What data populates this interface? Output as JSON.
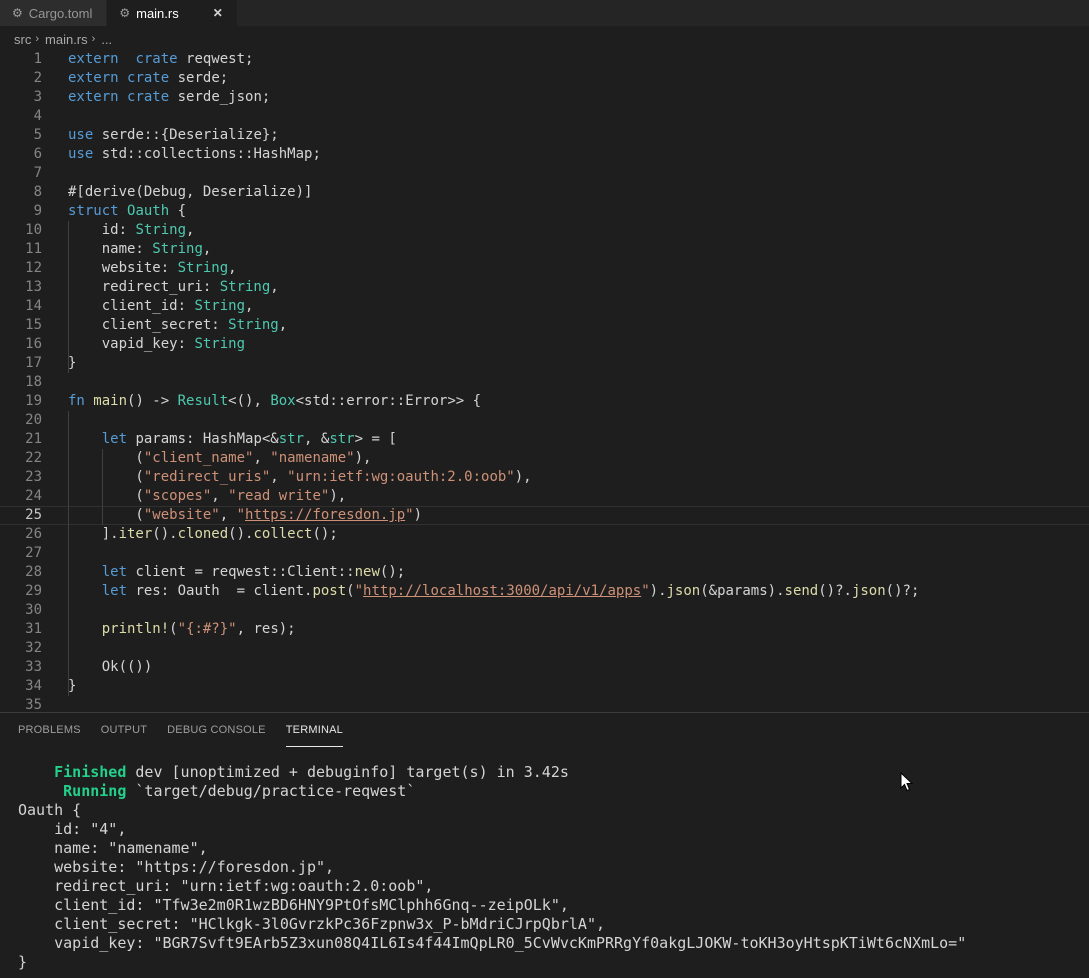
{
  "tabs": [
    {
      "icon": "gear-icon",
      "label": "Cargo.toml",
      "active": false
    },
    {
      "icon": "rust-file-icon",
      "label": "main.rs",
      "active": true
    }
  ],
  "tab_close": "✕",
  "breadcrumb": {
    "items": [
      "src",
      "main.rs",
      "..."
    ]
  },
  "editor": {
    "current_line": 25,
    "lines": [
      [
        [
          "k",
          "extern"
        ],
        [
          "",
          "  "
        ],
        [
          "k",
          "crate"
        ],
        [
          "",
          " reqwest;"
        ]
      ],
      [
        [
          "k",
          "extern"
        ],
        [
          "",
          " "
        ],
        [
          "k",
          "crate"
        ],
        [
          "",
          " serde;"
        ]
      ],
      [
        [
          "k",
          "extern"
        ],
        [
          "",
          " "
        ],
        [
          "k",
          "crate"
        ],
        [
          "",
          " serde_json;"
        ]
      ],
      [],
      [
        [
          "k",
          "use"
        ],
        [
          "",
          " serde::{Deserialize};"
        ]
      ],
      [
        [
          "k",
          "use"
        ],
        [
          "",
          " std::collections::HashMap;"
        ]
      ],
      [],
      [
        [
          "",
          "#[derive(Debug, Deserialize)]"
        ]
      ],
      [
        [
          "k",
          "struct"
        ],
        [
          "",
          " "
        ],
        [
          "t",
          "Oauth"
        ],
        [
          "",
          " {"
        ]
      ],
      [
        [
          "",
          "    id: "
        ],
        [
          "t",
          "String"
        ],
        [
          "",
          ","
        ]
      ],
      [
        [
          "",
          "    name: "
        ],
        [
          "t",
          "String"
        ],
        [
          "",
          ","
        ]
      ],
      [
        [
          "",
          "    website: "
        ],
        [
          "t",
          "String"
        ],
        [
          "",
          ","
        ]
      ],
      [
        [
          "",
          "    redirect_uri: "
        ],
        [
          "t",
          "String"
        ],
        [
          "",
          ","
        ]
      ],
      [
        [
          "",
          "    client_id: "
        ],
        [
          "t",
          "String"
        ],
        [
          "",
          ","
        ]
      ],
      [
        [
          "",
          "    client_secret: "
        ],
        [
          "t",
          "String"
        ],
        [
          "",
          ","
        ]
      ],
      [
        [
          "",
          "    vapid_key: "
        ],
        [
          "t",
          "String"
        ]
      ],
      [
        [
          "",
          "}"
        ]
      ],
      [],
      [
        [
          "k",
          "fn"
        ],
        [
          "",
          " "
        ],
        [
          "f",
          "main"
        ],
        [
          "",
          "() -> "
        ],
        [
          "t",
          "Result"
        ],
        [
          "",
          "<(), "
        ],
        [
          "t",
          "Box"
        ],
        [
          "",
          "<std::error::Error>> {"
        ]
      ],
      [],
      [
        [
          "",
          "    "
        ],
        [
          "k",
          "let"
        ],
        [
          "",
          " params: HashMap<&"
        ],
        [
          "t",
          "str"
        ],
        [
          "",
          ", &"
        ],
        [
          "t",
          "str"
        ],
        [
          "",
          "> = ["
        ]
      ],
      [
        [
          "",
          "        ("
        ],
        [
          "s",
          "\"client_name\""
        ],
        [
          "",
          ", "
        ],
        [
          "s",
          "\"namename\""
        ],
        [
          "",
          "),"
        ]
      ],
      [
        [
          "",
          "        ("
        ],
        [
          "s",
          "\"redirect_uris\""
        ],
        [
          "",
          ", "
        ],
        [
          "s",
          "\"urn:ietf:wg:oauth:2.0:oob\""
        ],
        [
          "",
          "),"
        ]
      ],
      [
        [
          "",
          "        ("
        ],
        [
          "s",
          "\"scopes\""
        ],
        [
          "",
          ", "
        ],
        [
          "s",
          "\"read write\""
        ],
        [
          "",
          "),"
        ]
      ],
      [
        [
          "",
          "        ("
        ],
        [
          "s",
          "\"website\""
        ],
        [
          "",
          ", "
        ],
        [
          "s",
          "\""
        ],
        [
          "u",
          "https://foresdon.jp"
        ],
        [
          "s",
          "\""
        ],
        [
          "",
          ")"
        ]
      ],
      [
        [
          "",
          "    ]."
        ],
        [
          "f",
          "iter"
        ],
        [
          "",
          "()."
        ],
        [
          "f",
          "cloned"
        ],
        [
          "",
          "()."
        ],
        [
          "f",
          "collect"
        ],
        [
          "",
          "();"
        ]
      ],
      [],
      [
        [
          "",
          "    "
        ],
        [
          "k",
          "let"
        ],
        [
          "",
          " client = reqwest::Client::"
        ],
        [
          "f",
          "new"
        ],
        [
          "",
          "();"
        ]
      ],
      [
        [
          "",
          "    "
        ],
        [
          "k",
          "let"
        ],
        [
          "",
          " res: Oauth  = client."
        ],
        [
          "f",
          "post"
        ],
        [
          "",
          "("
        ],
        [
          "s",
          "\""
        ],
        [
          "u",
          "http://localhost:3000/api/v1/apps"
        ],
        [
          "s",
          "\""
        ],
        [
          "",
          ")."
        ],
        [
          "f",
          "json"
        ],
        [
          "",
          "(&params)."
        ],
        [
          "f",
          "send"
        ],
        [
          "",
          "()?."
        ],
        [
          "f",
          "json"
        ],
        [
          "",
          "()?;"
        ]
      ],
      [],
      [
        [
          "",
          "    "
        ],
        [
          "f",
          "println!"
        ],
        [
          "",
          "("
        ],
        [
          "s",
          "\"{:#?}\""
        ],
        [
          "",
          ", res);"
        ]
      ],
      [],
      [
        [
          "",
          "    Ok(())"
        ]
      ],
      [
        [
          "",
          "}"
        ]
      ],
      []
    ]
  },
  "panel": {
    "tabs": [
      "PROBLEMS",
      "OUTPUT",
      "DEBUG CONSOLE",
      "TERMINAL"
    ],
    "active": 3
  },
  "terminal": {
    "lines": [
      [
        [
          "green",
          "    Finished"
        ],
        [
          "",
          " dev [unoptimized + debuginfo] target(s) in 3.42s"
        ]
      ],
      [
        [
          "green",
          "     Running"
        ],
        [
          "",
          " `target/debug/practice-reqwest`"
        ]
      ],
      [
        [
          "",
          "Oauth {"
        ]
      ],
      [
        [
          "",
          "    id: \"4\","
        ]
      ],
      [
        [
          "",
          "    name: \"namename\","
        ]
      ],
      [
        [
          "",
          "    website: \"https://foresdon.jp\","
        ]
      ],
      [
        [
          "",
          "    redirect_uri: \"urn:ietf:wg:oauth:2.0:oob\","
        ]
      ],
      [
        [
          "",
          "    client_id: \"Tfw3e2m0R1wzBD6HNY9PtOfsMClphh6Gnq--zeipOLk\","
        ]
      ],
      [
        [
          "",
          "    client_secret: \"HClkgk-3l0GvrzkPc36Fzpnw3x_P-bMdriCJrpQbrlA\","
        ]
      ],
      [
        [
          "",
          "    vapid_key: \"BGR7Svft9EArb5Z3xun08Q4IL6Is4f44ImQpLR0_5CvWvcKmPRRgYf0akgLJOKW-toKH3oyHtspKTiWt6cNXmLo=\""
        ]
      ],
      [
        [
          "",
          "}"
        ]
      ]
    ]
  }
}
